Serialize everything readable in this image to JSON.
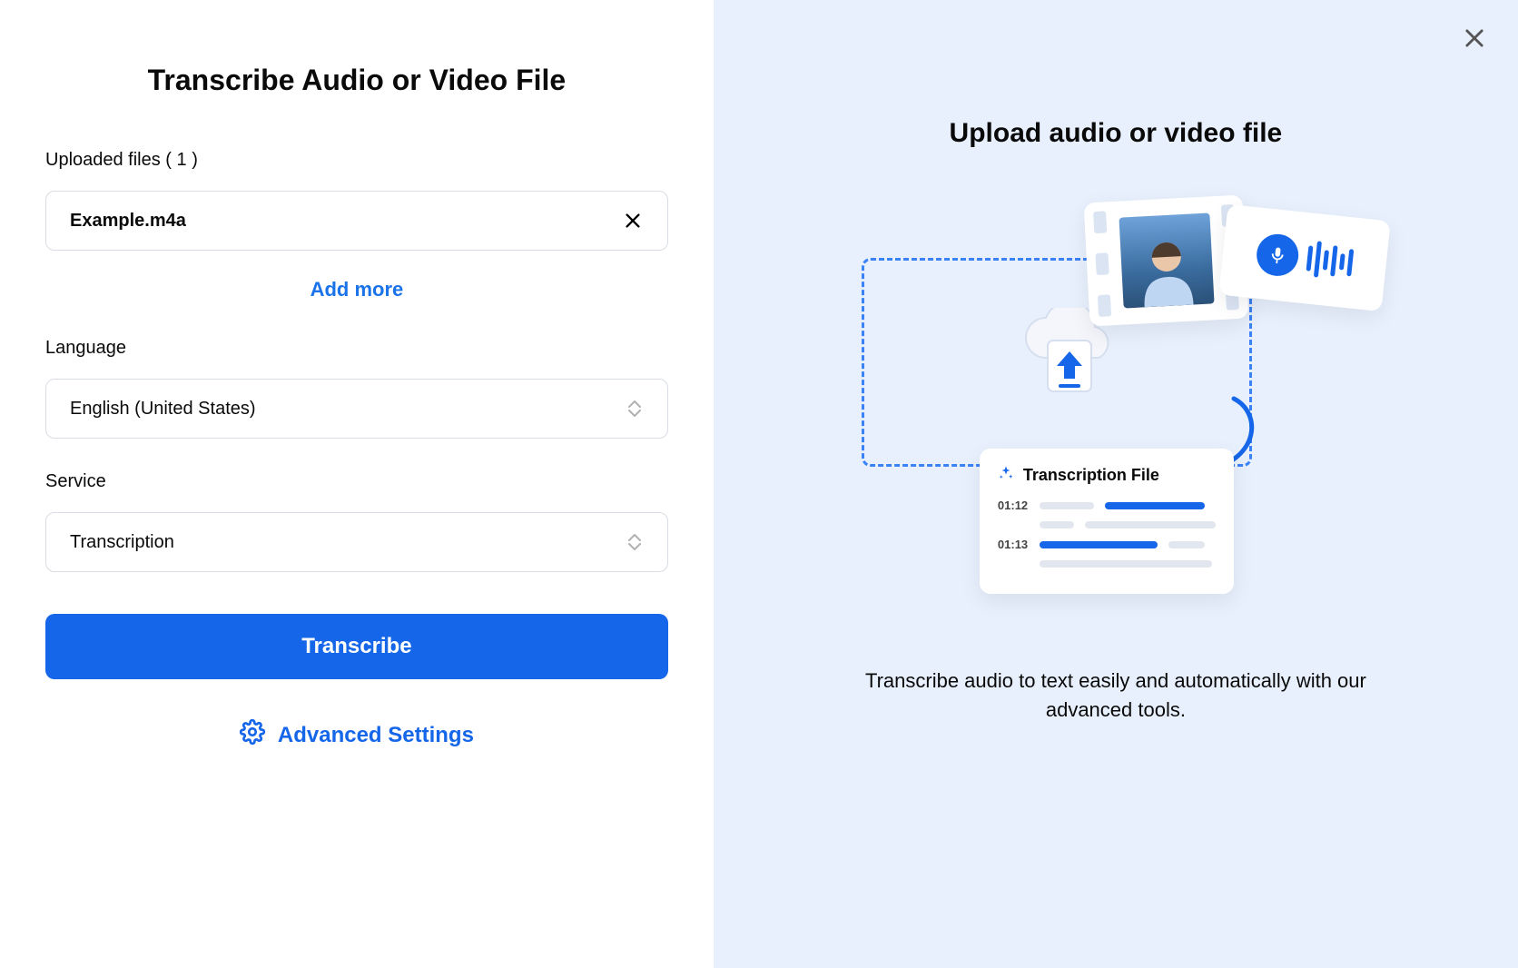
{
  "left": {
    "title": "Transcribe Audio or Video File",
    "uploaded_label": "Uploaded files ( 1 )",
    "files": [
      {
        "name": "Example.m4a"
      }
    ],
    "add_more": "Add more",
    "language_label": "Language",
    "language_value": "English (United States)",
    "service_label": "Service",
    "service_value": "Transcription",
    "transcribe_btn": "Transcribe",
    "advanced_settings": "Advanced Settings"
  },
  "right": {
    "title": "Upload audio or video file",
    "caption": "Transcribe audio to text easily and automatically with our advanced tools.",
    "transcript_card": {
      "header": "Transcription File",
      "rows": [
        {
          "ts": "01:12"
        },
        {
          "ts": "01:13"
        }
      ]
    }
  }
}
